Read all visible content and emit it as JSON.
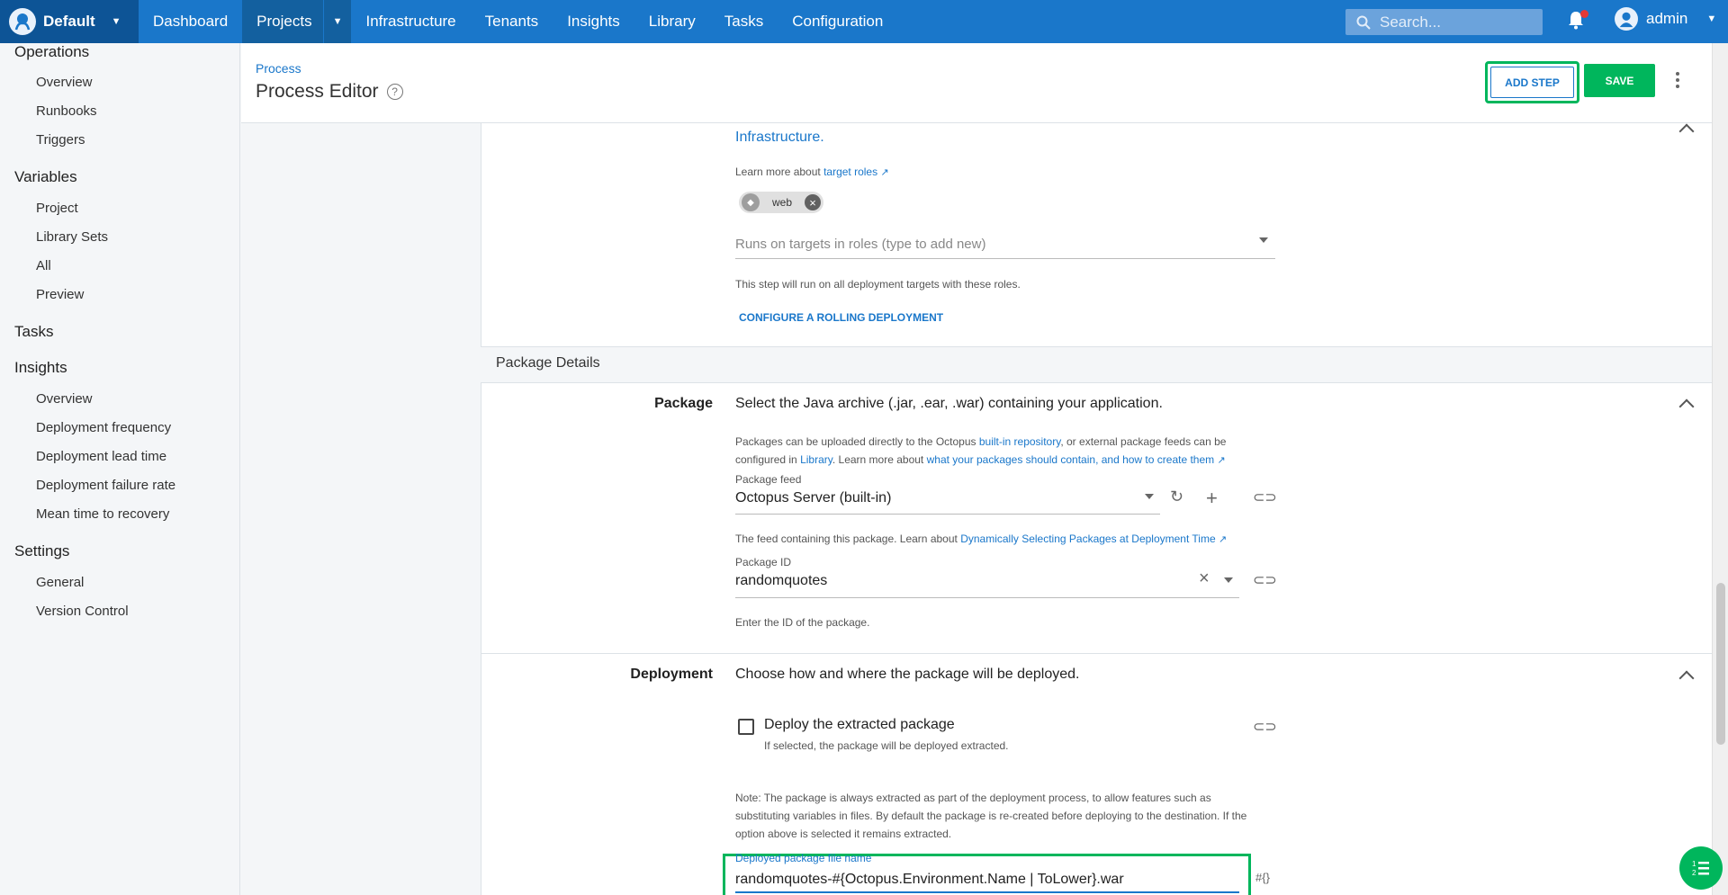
{
  "space": {
    "name": "Default"
  },
  "nav": {
    "items": [
      "Dashboard",
      "Projects",
      "Infrastructure",
      "Tenants",
      "Insights",
      "Library",
      "Tasks",
      "Configuration"
    ]
  },
  "search": {
    "placeholder": "Search..."
  },
  "user": {
    "name": "admin"
  },
  "sidebar": {
    "operations": "Operations",
    "operations_items": [
      "Overview",
      "Runbooks",
      "Triggers"
    ],
    "variables": "Variables",
    "variables_items": [
      "Project",
      "Library Sets",
      "All",
      "Preview"
    ],
    "tasks": "Tasks",
    "insights": "Insights",
    "insights_items": [
      "Overview",
      "Deployment frequency",
      "Deployment lead time",
      "Deployment failure rate",
      "Mean time to recovery"
    ],
    "settings": "Settings",
    "settings_items": [
      "General",
      "Version Control"
    ]
  },
  "header": {
    "breadcrumb": "Process",
    "title": "Process Editor",
    "add_step": "ADD STEP",
    "save": "SAVE"
  },
  "roles": {
    "infra_link": "Infrastructure.",
    "learn_prefix": "Learn more about",
    "learn_link": "target roles",
    "chip": "web",
    "select_placeholder": "Runs on targets in roles (type to add new)",
    "hint": "This step will run on all deployment targets with these roles.",
    "rolling": "CONFIGURE A ROLLING DEPLOYMENT"
  },
  "package_details": {
    "section_title": "Package Details",
    "label": "Package",
    "desc": "Select the Java archive (.jar, .ear, .war) containing your application.",
    "info_1": "Packages can be uploaded directly to the Octopus",
    "info_link_1": "built-in repository",
    "info_2": ", or external package feeds can be",
    "info_3": "configured in",
    "info_link_2": "Library",
    "info_4": ". Learn more about",
    "info_link_3": "what your packages should contain, and how to create them",
    "feed_label": "Package feed",
    "feed_value": "Octopus Server (built-in)",
    "feed_hint_prefix": "The feed containing this package. Learn about",
    "feed_hint_link": "Dynamically Selecting Packages at Deployment Time",
    "id_label": "Package ID",
    "id_value": "randomquotes",
    "id_hint": "Enter the ID of the package."
  },
  "deployment": {
    "label": "Deployment",
    "desc": "Choose how and where the package will be deployed.",
    "checkbox_label": "Deploy the extracted package",
    "checkbox_hint": "If selected, the package will be deployed extracted.",
    "note_1": "Note: The package is always extracted as part of the deployment process, to allow features such as",
    "note_2": "substituting variables in files. By default the package is re-created before deploying to the destination. If the",
    "note_3": "option above is selected it remains extracted.",
    "filename_label": "Deployed package file name",
    "filename_value": "randomquotes-#{Octopus.Environment.Name | ToLower}.war",
    "var_icon": "#{}"
  }
}
